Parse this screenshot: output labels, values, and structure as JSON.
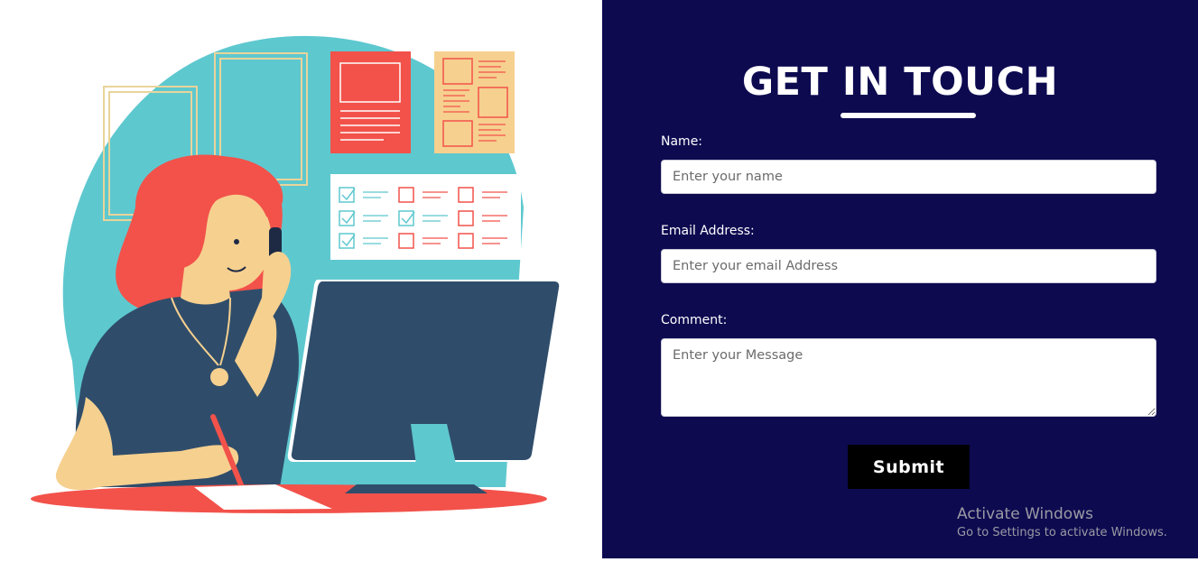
{
  "contact": {
    "title": "GET IN TOUCH",
    "name_label": "Name:",
    "name_placeholder": "Enter your name",
    "email_label": "Email Address:",
    "email_placeholder": "Enter your email Address",
    "comment_label": "Comment:",
    "comment_placeholder": "Enter your Message",
    "submit_label": "Submit"
  },
  "watermark": {
    "title": "Activate Windows",
    "subtitle": "Go to Settings to activate Windows."
  },
  "colors": {
    "panel_bg": "#0d0a50",
    "teal": "#5ec8cf",
    "coral": "#f2524a",
    "peach": "#f6d08f",
    "navy": "#2f4d6b"
  },
  "illustration": {
    "subject": "woman-on-phone-at-computer-illustration"
  }
}
